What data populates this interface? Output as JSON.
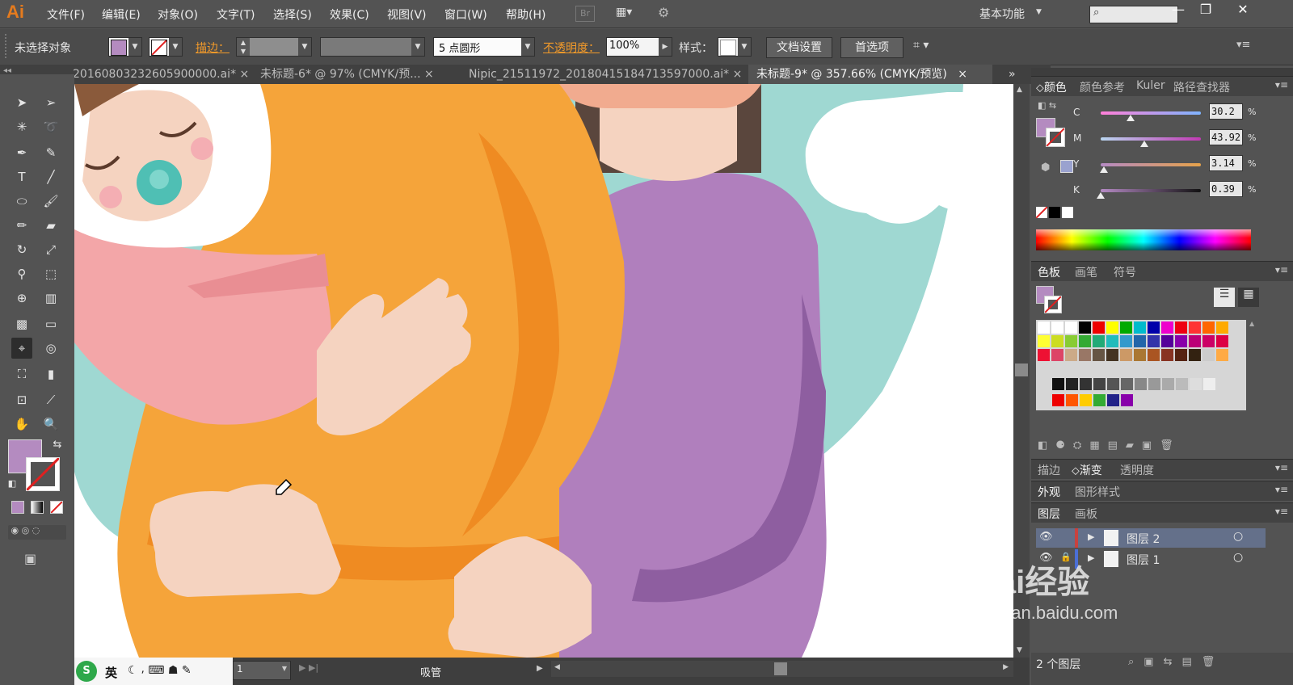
{
  "app": {
    "logo": "Ai"
  },
  "menu": [
    "文件(F)",
    "编辑(E)",
    "对象(O)",
    "文字(T)",
    "选择(S)",
    "效果(C)",
    "视图(V)",
    "窗口(W)",
    "帮助(H)"
  ],
  "menubar_icons": {
    "bridge": "Br"
  },
  "workspace": "基本功能",
  "control": {
    "selection_status": "未选择对象",
    "stroke_label": "描边：",
    "brush_value": "5 点圆形",
    "opacity_label": "不透明度：",
    "opacity_value": "100%",
    "style_label": "样式：",
    "doc_setup": "文档设置",
    "preferences": "首选项"
  },
  "tabs": [
    {
      "label": "20160803232605900000.ai*",
      "close": "×",
      "active": false
    },
    {
      "label": "未标题-6* @ 97% (CMYK/预...",
      "close": "×",
      "active": false
    },
    {
      "label": "Nipic_21511972_20180415184713597000.ai*",
      "close": "×",
      "active": false
    },
    {
      "label": "未标题-9* @ 357.66% (CMYK/预览)",
      "close": "×",
      "active": true
    }
  ],
  "color_panel": {
    "tabs": [
      "颜色",
      "颜色参考",
      "Kuler",
      "路径查找器"
    ],
    "channels": [
      {
        "name": "C",
        "value": "30.2",
        "unit": "%",
        "level": 0.302
      },
      {
        "name": "M",
        "value": "43.92",
        "unit": "%",
        "level": 0.4392
      },
      {
        "name": "Y",
        "value": "3.14",
        "unit": "%",
        "level": 0.0314
      },
      {
        "name": "K",
        "value": "0.39",
        "unit": "%",
        "level": 0.0039
      }
    ],
    "fill_color": "#b48bc0"
  },
  "swatches_panel": {
    "tabs": [
      "色板",
      "画笔",
      "符号"
    ]
  },
  "stroke_panel": {
    "tabs": [
      "描边",
      "渐变",
      "透明度"
    ]
  },
  "appearance_panel": {
    "tabs": [
      "外观",
      "图形样式"
    ]
  },
  "layers_panel": {
    "tabs": [
      "图层",
      "画板"
    ],
    "layers": [
      {
        "name": "图层 2",
        "color": "#c9423f"
      },
      {
        "name": "图层 1",
        "color": "#4b6fd6"
      }
    ],
    "count": "2 个图层"
  },
  "status": {
    "zoom_page": "1",
    "tool_name": "吸管"
  },
  "ime": {
    "lang": "英"
  },
  "watermark": {
    "brand": "Bai经验",
    "url": "jingyan.baidu.com"
  },
  "colors": {
    "accent_orange": "#f5a43a",
    "purple": "#b07fbd",
    "teal": "#9fd8d2",
    "skin": "#f5d3c0",
    "pink": "#f3a6a8"
  }
}
